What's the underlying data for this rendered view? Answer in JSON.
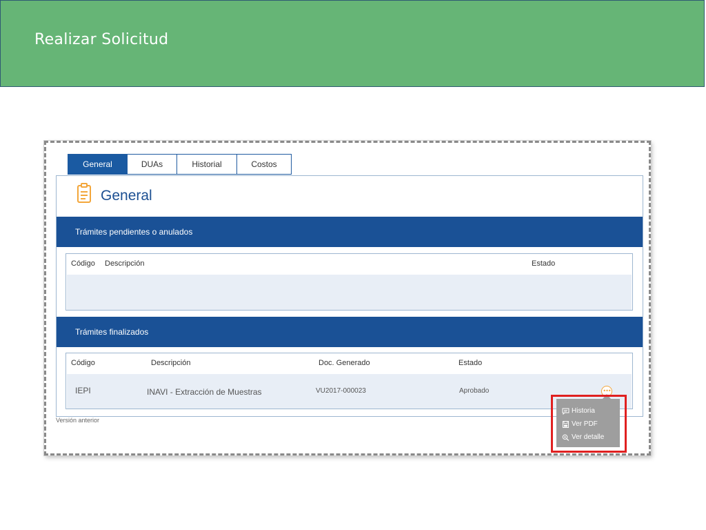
{
  "header": {
    "title": "Realizar Solicitud"
  },
  "tabs": [
    {
      "label": "General",
      "active": true
    },
    {
      "label": "DUAs",
      "active": false
    },
    {
      "label": "Historial",
      "active": false
    },
    {
      "label": "Costos",
      "active": false
    }
  ],
  "page_title": "General",
  "pending_section": {
    "title": "Trámites pendientes o anulados",
    "columns": [
      "Código",
      "Descripción",
      "Estado"
    ],
    "rows": []
  },
  "finished_section": {
    "title": "Trámites finalizados",
    "columns": [
      "Código",
      "Descripción",
      "Doc. Generado",
      "Estado"
    ],
    "rows": [
      {
        "codigo": "IEPI",
        "descripcion": "INAVI - Extracción de Muestras",
        "doc_generado": "VU2017-000023",
        "estado": "Aprobado"
      }
    ]
  },
  "version_link": "Versión anterior",
  "context_menu": {
    "items": [
      {
        "label": "Historia",
        "icon": "chat-bubble-icon"
      },
      {
        "label": "Ver PDF",
        "icon": "save-icon"
      },
      {
        "label": "Ver detalle",
        "icon": "zoom-in-icon"
      }
    ]
  },
  "colors": {
    "header_green": "#66b576",
    "primary_blue": "#1a5196",
    "accent_orange": "#f3a63a",
    "highlight_red": "#e02020"
  }
}
